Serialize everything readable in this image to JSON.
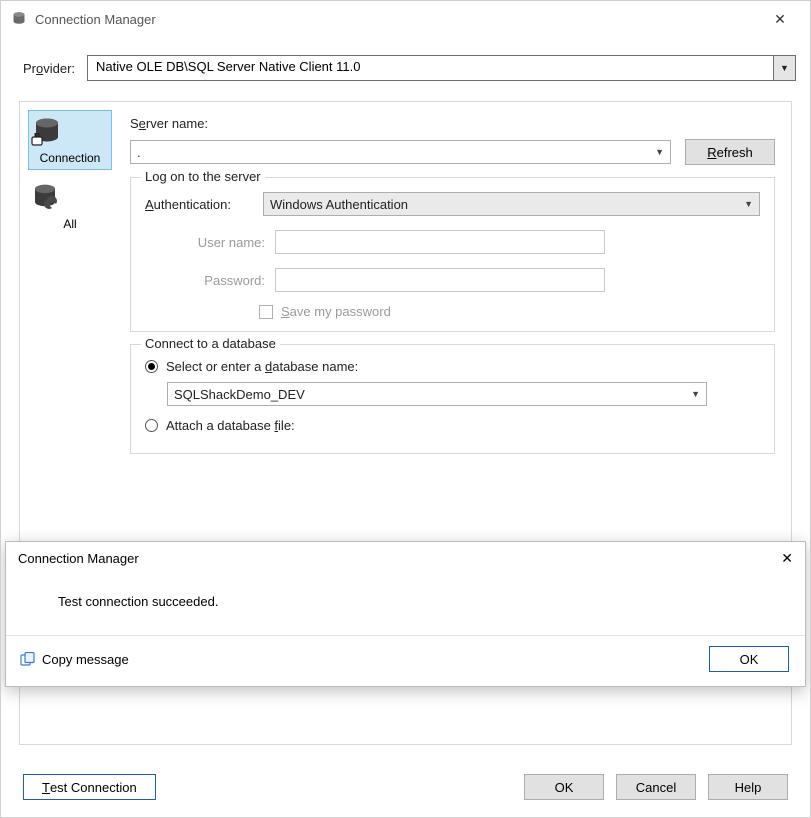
{
  "window": {
    "title": "Connection Manager"
  },
  "provider": {
    "label_pre": "Pr",
    "label_u": "o",
    "label_post": "vider:",
    "value": "Native OLE DB\\SQL Server Native Client 11.0"
  },
  "sidebar": {
    "connection": "Connection",
    "all": "All"
  },
  "form": {
    "server_label_pre": "S",
    "server_label_u": "e",
    "server_label_post": "rver name:",
    "server_value": ".",
    "refresh_u": "R",
    "refresh_post": "efresh"
  },
  "logon": {
    "legend": "Log on to the server",
    "auth_u": "A",
    "auth_post": "uthentication:",
    "auth_value": "Windows Authentication",
    "user_u": "U",
    "user_post": "ser name:",
    "user_value": "",
    "pass_u": "P",
    "pass_post": "assword:",
    "pass_value": "",
    "save_u": "S",
    "save_post": "ave my password"
  },
  "db": {
    "legend": "Connect to a database",
    "opt1_pre": "Select or enter a ",
    "opt1_u": "d",
    "opt1_post": "atabase name:",
    "selected_db": "SQLShackDemo_DEV",
    "opt2_pre": "Attach a database ",
    "opt2_u": "f",
    "opt2_post": "ile:"
  },
  "buttons": {
    "test_u": "T",
    "test_post": "est Connection",
    "ok": "OK",
    "cancel": "Cancel",
    "help": "Help"
  },
  "overlay": {
    "title": "Connection Manager",
    "message": "Test connection succeeded.",
    "copy": "Copy message",
    "ok": "OK"
  }
}
